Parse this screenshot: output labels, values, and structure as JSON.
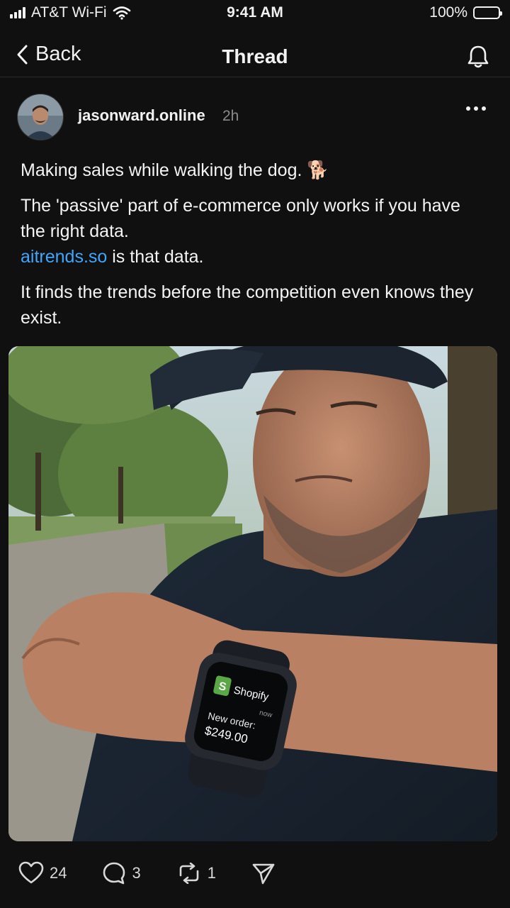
{
  "status_bar": {
    "carrier": "AT&T Wi-Fi",
    "time": "9:41 AM",
    "battery": "100%"
  },
  "nav": {
    "back_label": "Back",
    "title": "Thread"
  },
  "post": {
    "author": "jasonward.online",
    "time_ago": "2h",
    "line1": "Making sales while walking the dog. 🐕",
    "line2": "The 'passive' part of e-commerce only works if you have the right data.",
    "link": "aitrends.so",
    "line3_rest": " is that data.",
    "line4": "It finds the trends before the competition even knows they exist.",
    "watch": {
      "app": "Shopify",
      "time": "now",
      "label": "New order:",
      "amount": "$249.00"
    }
  },
  "actions": {
    "likes": "24",
    "replies": "3",
    "reposts": "1"
  },
  "colors": {
    "background": "#101010",
    "link": "#3ea6ff",
    "shopify_green": "#5aa845"
  }
}
